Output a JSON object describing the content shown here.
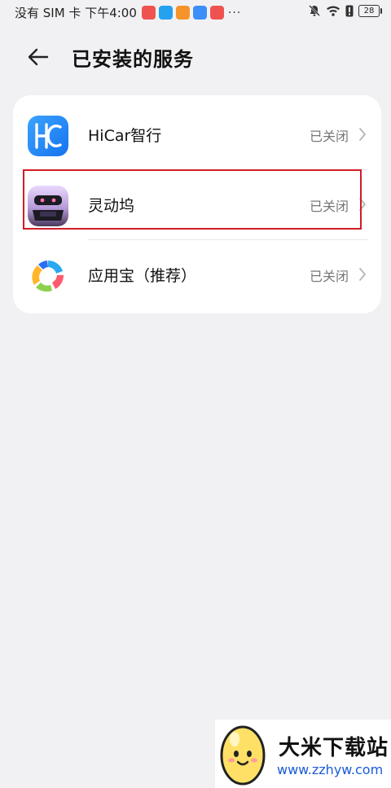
{
  "status_bar": {
    "carrier_time": "没有 SIM 卡 下午4:00",
    "notification_app_colors": [
      "#ef5350",
      "#26a1f0",
      "#f7932b",
      "#3d8ef8",
      "#ef5350"
    ],
    "overflow": "···",
    "battery": "28"
  },
  "header": {
    "back_icon": "arrow-left-icon",
    "title": "已安装的服务"
  },
  "services": [
    {
      "name": "HiCar智行",
      "status": "已关闭",
      "icon": "hicar-icon"
    },
    {
      "name": "灵动坞",
      "status": "已关闭",
      "icon": "lingdongwu-icon"
    },
    {
      "name": "应用宝（推荐）",
      "status": "已关闭",
      "icon": "yingyongbao-icon"
    }
  ],
  "highlight_color": "#d21c26",
  "watermark": {
    "title": "大米下载站",
    "url": "www.zzhyw.com"
  }
}
